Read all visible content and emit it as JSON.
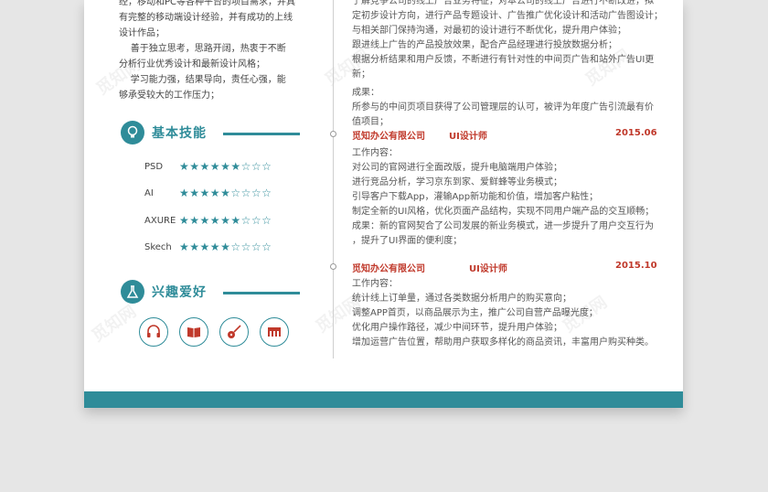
{
  "left": {
    "intro_lines": [
      "经，移动和PC等各种平台的项目需求，并具",
      "有完整的移动端设计经验，并有成功的上线",
      "设计作品；",
      "    善于独立思考，思路开阔，热衷于不断",
      "分析行业优秀设计和最新设计风格；",
      "    学习能力强，结果导向，责任心强，能",
      "够承受较大的工作压力；"
    ],
    "skills_title": "基本技能",
    "skills": [
      {
        "name": "PSD",
        "rating": 6,
        "max": 9
      },
      {
        "name": "AI",
        "rating": 5,
        "max": 9
      },
      {
        "name": "AXURE",
        "rating": 6,
        "max": 9
      },
      {
        "name": "Skech",
        "rating": 5,
        "max": 9
      }
    ],
    "hobbies_title": "兴趣爱好",
    "hobbies": [
      "headphones-icon",
      "book-icon",
      "guitar-icon",
      "piano-icon"
    ]
  },
  "right": {
    "top_lines": [
      "了解竞争公司的线上广告业务特征，对本公司的线上广告进行不断改进，拟",
      "定初步设计方向，进行产品专题设计、广告推广优化设计和活动广告图设计；",
      "与相关部门保持沟通，对最初的设计进行不断优化，提升用户体验；",
      "跟进线上广告的产品投放效果，配合产品经理进行投放数据分析；",
      "根据分析结果和用户反馈，不断进行有针对性的中间页广告和站外广告UI更新；"
    ],
    "result_label": "成果：",
    "result_lines": [
      "所参与的中间页项目获得了公司管理层的认可，被评为年度广告引流最有价",
      "值项目；"
    ],
    "jobs": [
      {
        "company": "觅知办公有限公司",
        "title": "UI设计师",
        "date": "2015.06",
        "content_label": "工作内容：",
        "lines": [
          "对公司的官网进行全面改版，提升电脑端用户体验；",
          "进行竞品分析，学习京东到家、爱鲜蜂等业务模式；",
          "引导客户下载App，灌输App新功能和价值，增加客户粘性；",
          "制定全新的UI风格，优化页面产品结构，实现不同用户端产品的交互顺畅；",
          "成果：新的官网契合了公司发展的新业务模式，进一步提升了用户交互行为",
          "，提升了UI界面的便利度；"
        ]
      },
      {
        "company": "觅知办公有限公司",
        "title": "UI设计师",
        "date": "2015.10",
        "content_label": "工作内容：",
        "lines": [
          "统计线上订单量，通过各类数据分析用户的购买意向；",
          "调整APP首页，以商品展示为主，推广公司自营产品曝光度；",
          "优化用户操作路径，减少中间环节，提升用户体验；",
          "增加运营广告位置，帮助用户获取多样化的商品资讯，丰富用户购买种类。"
        ]
      }
    ]
  },
  "watermark": "觅知网",
  "colors": {
    "accent": "#2f8c99",
    "highlight": "#c0392b"
  }
}
